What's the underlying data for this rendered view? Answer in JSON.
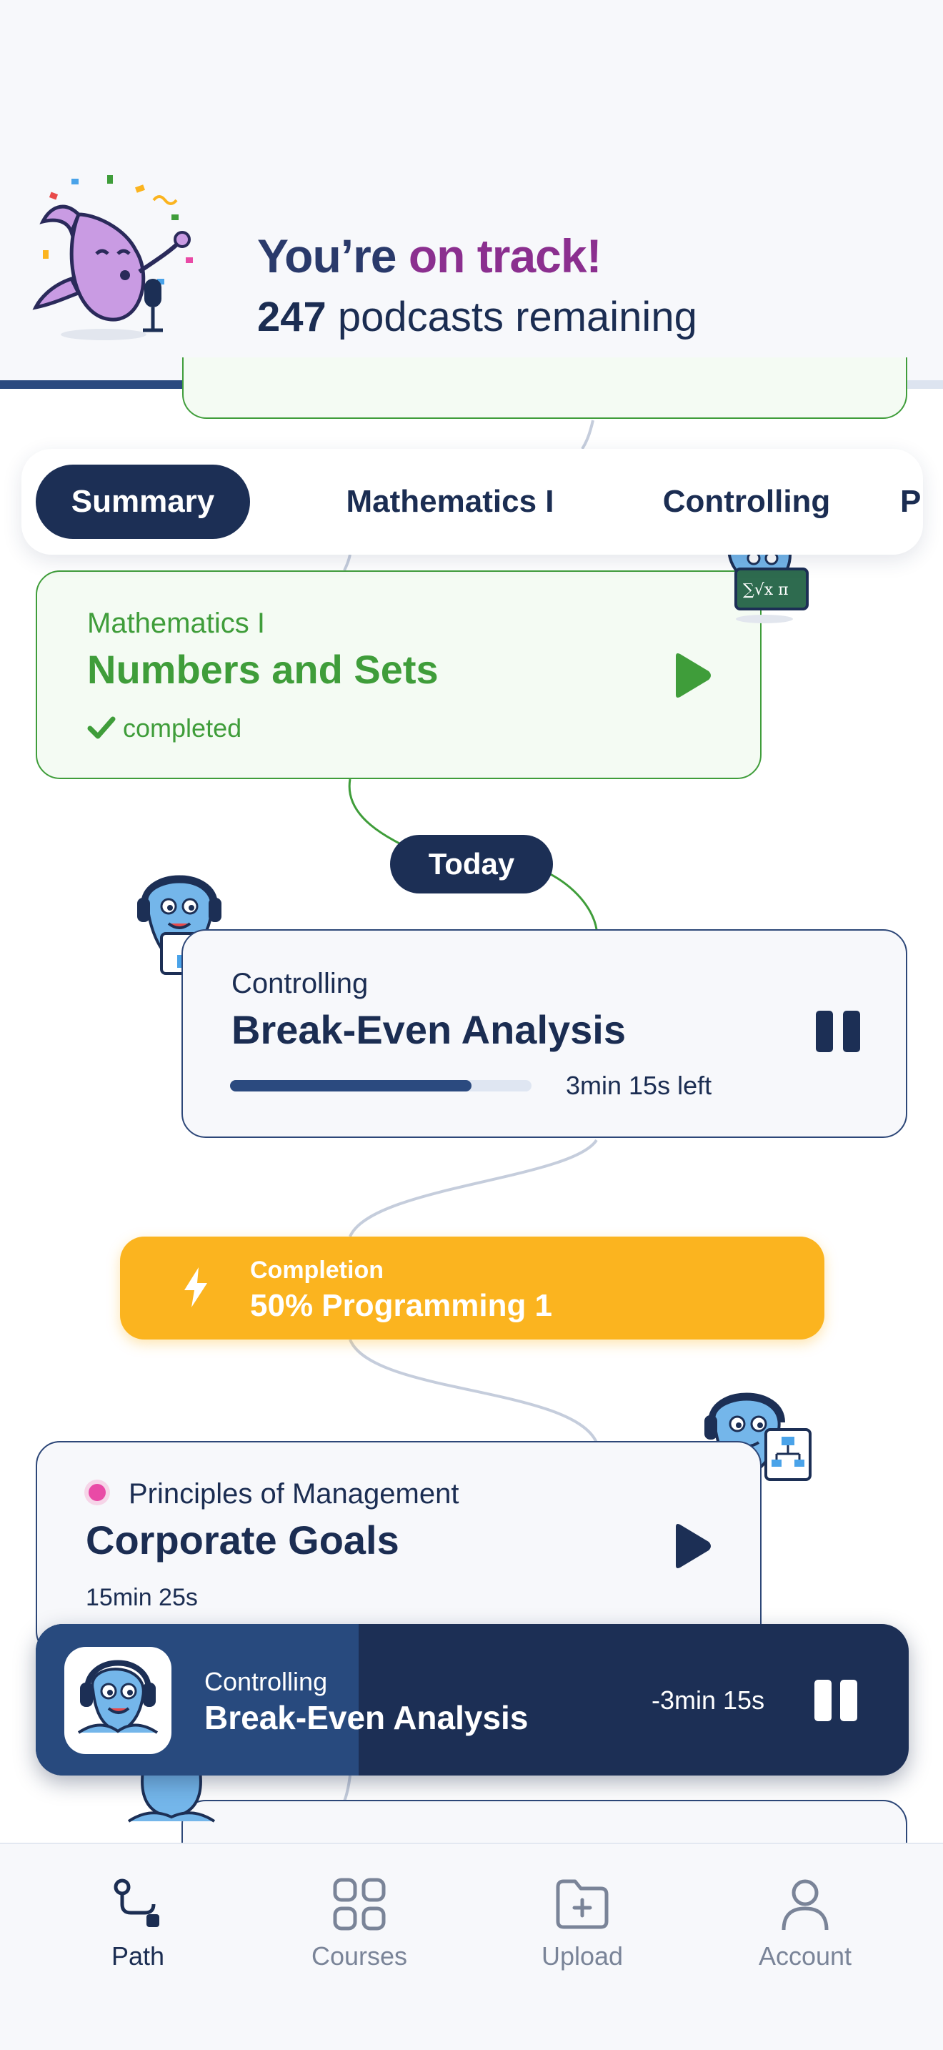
{
  "header": {
    "title_start": "You’re ",
    "title_accent": "on track!",
    "remaining_count": "247",
    "remaining_label": " podcasts remaining",
    "overall_progress": 0.815
  },
  "tabs": [
    "Summary",
    "Mathematics I",
    "Controlling",
    "P"
  ],
  "path": {
    "completed_card": {
      "course": "Mathematics I",
      "title": "Numbers and Sets",
      "status": "completed"
    },
    "today_label": "Today",
    "current_card": {
      "course": "Controlling",
      "title": "Break-Even Analysis",
      "progress": 0.8,
      "time_left": "3min 15s left"
    },
    "milestone": {
      "label": "Completion",
      "value": "50% Programming 1"
    },
    "next_card": {
      "course": "Principles of Management",
      "title": "Corporate Goals",
      "duration": "15min 25s"
    }
  },
  "mini_player": {
    "course": "Controlling",
    "title": "Break-Even Analysis",
    "remaining": "-3min 15s",
    "progress": 0.37
  },
  "nav": [
    {
      "label": "Path",
      "icon": "path-icon",
      "active": true
    },
    {
      "label": "Courses",
      "icon": "grid-icon",
      "active": false
    },
    {
      "label": "Upload",
      "icon": "folder-plus-icon",
      "active": false
    },
    {
      "label": "Account",
      "icon": "user-icon",
      "active": false
    }
  ],
  "colors": {
    "navy": "#1c2f55",
    "accent_purple": "#8b2f8f",
    "green": "#3f9d3a",
    "amber": "#fbb41f",
    "pink_dot": "#e94aa6"
  }
}
